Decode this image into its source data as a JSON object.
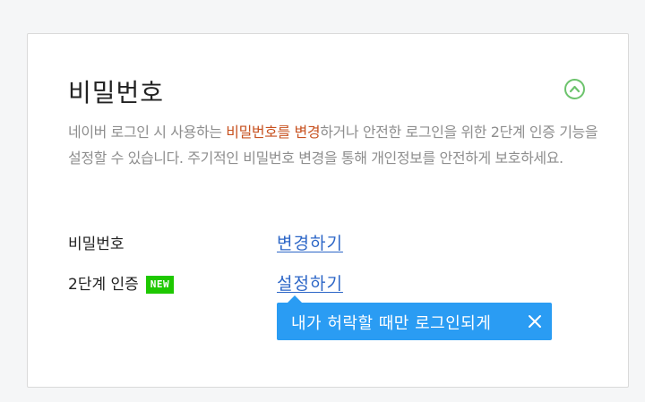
{
  "section": {
    "title": "비밀번호",
    "description_before": "네이버 로그인 시 사용하는 ",
    "description_highlight": "비밀번호를 변경",
    "description_after": "하거나 안전한 로그인을 위한 2단계 인증 기능을 설정할 수 있습니다. 주기적인 비밀번호 변경을 통해 개인정보를 안전하게 보호하세요.",
    "collapse_icon": "chevron-up-circle-icon"
  },
  "rows": {
    "password_label": "비밀번호",
    "password_action": "변경하기",
    "two_factor_label": "2단계 인증",
    "two_factor_badge": "NEW",
    "two_factor_action": "설정하기"
  },
  "tooltip": {
    "text": "내가 허락할 때만 로그인되게",
    "close_icon": "close-icon"
  },
  "colors": {
    "accent_green": "#6cc36c",
    "badge_green": "#1ec800",
    "highlight_orange": "#c7511f",
    "link_blue": "#2c66c7",
    "tooltip_blue": "#2a9cf3"
  }
}
